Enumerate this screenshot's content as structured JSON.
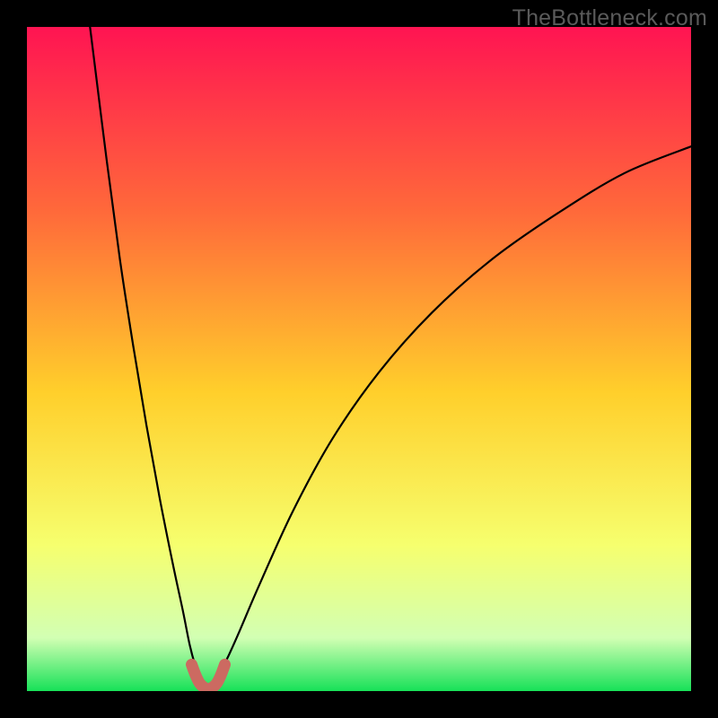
{
  "watermark": "TheBottleneck.com",
  "chart_data": {
    "type": "line",
    "title": "",
    "xlabel": "",
    "ylabel": "",
    "xlim": [
      0,
      100
    ],
    "ylim": [
      0,
      100
    ],
    "series": [
      {
        "name": "left-branch",
        "x": [
          9.5,
          10,
          12,
          14,
          16,
          18,
          20,
          22,
          23.5,
          24.5,
          25.3,
          26.0,
          26.5,
          27.0,
          27.3
        ],
        "y": [
          100,
          96,
          80,
          65,
          52,
          40,
          29,
          19,
          12,
          7,
          4,
          2.2,
          1.2,
          0.6,
          0.3
        ]
      },
      {
        "name": "right-branch",
        "x": [
          27.3,
          27.6,
          28.2,
          29.0,
          30.2,
          32,
          35,
          40,
          46,
          53,
          61,
          70,
          80,
          90,
          100
        ],
        "y": [
          0.3,
          0.6,
          1.4,
          2.8,
          5,
          9,
          16,
          27,
          38,
          48,
          57,
          65,
          72,
          78,
          82
        ]
      },
      {
        "name": "bottom-marker",
        "x": [
          24.8,
          25.4,
          26.0,
          26.6,
          27.3,
          28.0,
          28.6,
          29.2,
          29.8
        ],
        "y": [
          4.0,
          2.4,
          1.2,
          0.6,
          0.3,
          0.6,
          1.2,
          2.4,
          4.0
        ]
      }
    ],
    "gradient_colors": {
      "top": "#ff1452",
      "upper_mid": "#ff6a3a",
      "mid": "#ffcf2b",
      "lower_mid": "#f6ff6e",
      "low": "#d2ffb3",
      "bottom": "#17e158"
    },
    "marker_color": "#cc6a61",
    "curve_color": "#000000"
  }
}
